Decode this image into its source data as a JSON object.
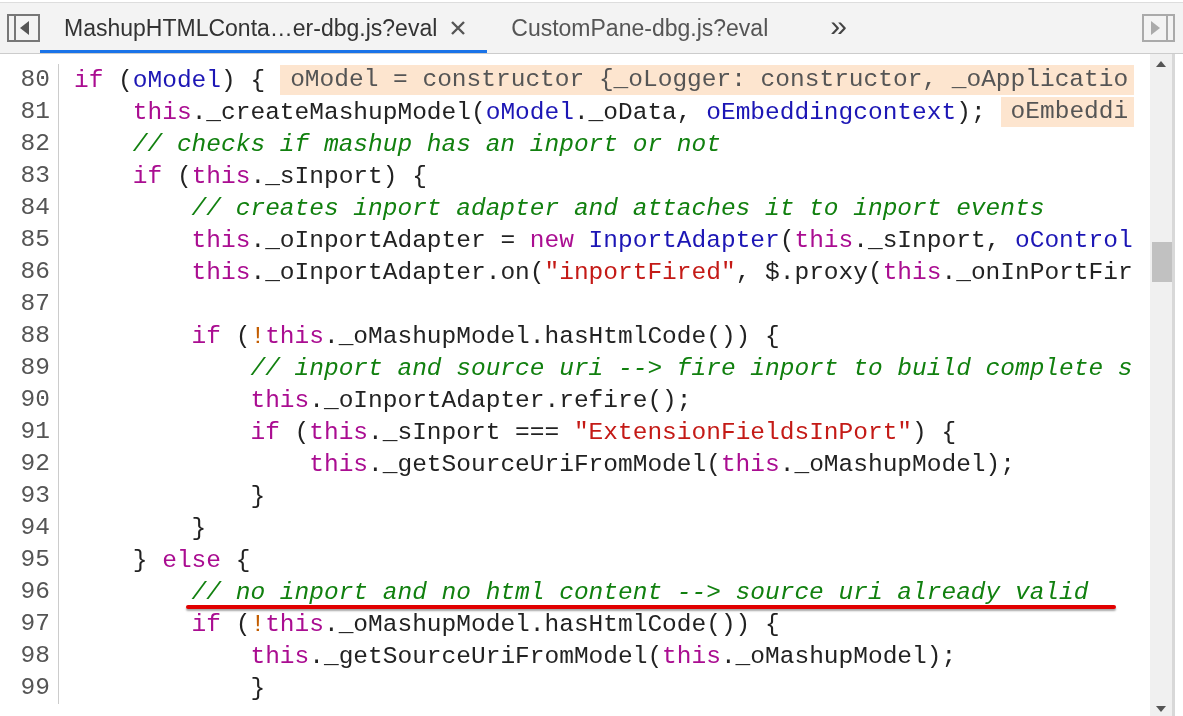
{
  "tabs": [
    {
      "label": "MashupHTMLConta…er-dbg.js?eval",
      "selected": true
    },
    {
      "label": "CustomPane-dbg.js?eval",
      "selected": false
    }
  ],
  "overflow": "»",
  "code_lines": [
    {
      "number": "80",
      "tokens": [
        {
          "kind": "kw",
          "text": "if"
        },
        {
          "kind": "plain",
          "text": " ("
        },
        {
          "kind": "var",
          "text": "oModel"
        },
        {
          "kind": "plain",
          "text": ") {"
        }
      ],
      "hint": "oModel = constructor {_oLogger: constructor, _oApplicatio"
    },
    {
      "number": "81",
      "tokens": [
        {
          "kind": "kw",
          "text": "    this"
        },
        {
          "kind": "plain",
          "text": "._createMashupModel("
        },
        {
          "kind": "var",
          "text": "oModel"
        },
        {
          "kind": "plain",
          "text": "._oData, "
        },
        {
          "kind": "var",
          "text": "oEmbeddingcontext"
        },
        {
          "kind": "plain",
          "text": ");"
        }
      ],
      "hint": "oEmbeddi"
    },
    {
      "number": "82",
      "tokens": [
        {
          "kind": "comment",
          "text": "    // checks if mashup has an inport or not"
        }
      ]
    },
    {
      "number": "83",
      "tokens": [
        {
          "kind": "kw",
          "text": "    if"
        },
        {
          "kind": "plain",
          "text": " ("
        },
        {
          "kind": "kw",
          "text": "this"
        },
        {
          "kind": "plain",
          "text": "._sInport) {"
        }
      ]
    },
    {
      "number": "84",
      "tokens": [
        {
          "kind": "comment",
          "text": "        // creates inport adapter and attaches it to inport events"
        }
      ]
    },
    {
      "number": "85",
      "tokens": [
        {
          "kind": "kw",
          "text": "        this"
        },
        {
          "kind": "plain",
          "text": "._oInportAdapter = "
        },
        {
          "kind": "kw",
          "text": "new "
        },
        {
          "kind": "var",
          "text": "InportAdapter"
        },
        {
          "kind": "plain",
          "text": "("
        },
        {
          "kind": "kw",
          "text": "this"
        },
        {
          "kind": "plain",
          "text": "._sInport, "
        },
        {
          "kind": "var",
          "text": "oControl"
        }
      ]
    },
    {
      "number": "86",
      "tokens": [
        {
          "kind": "kw",
          "text": "        this"
        },
        {
          "kind": "plain",
          "text": "._oInportAdapter.on("
        },
        {
          "kind": "str",
          "text": "\"inportFired\""
        },
        {
          "kind": "plain",
          "text": ", $.proxy("
        },
        {
          "kind": "kw",
          "text": "this"
        },
        {
          "kind": "plain",
          "text": "._onInPortFir"
        }
      ]
    },
    {
      "number": "87"
    },
    {
      "number": "88",
      "tokens": [
        {
          "kind": "kw",
          "text": "        if"
        },
        {
          "kind": "plain",
          "text": " ("
        },
        {
          "kind": "op",
          "text": "!"
        },
        {
          "kind": "kw",
          "text": "this"
        },
        {
          "kind": "plain",
          "text": "._oMashupModel.hasHtmlCode()) {"
        }
      ]
    },
    {
      "number": "89",
      "tokens": [
        {
          "kind": "comment",
          "text": "            // inport and source uri --> fire inport to build complete s"
        }
      ]
    },
    {
      "number": "90",
      "tokens": [
        {
          "kind": "kw",
          "text": "            this"
        },
        {
          "kind": "plain",
          "text": "._oInportAdapter.refire();"
        }
      ]
    },
    {
      "number": "91",
      "tokens": [
        {
          "kind": "kw",
          "text": "            if"
        },
        {
          "kind": "plain",
          "text": " ("
        },
        {
          "kind": "kw",
          "text": "this"
        },
        {
          "kind": "plain",
          "text": "._sInport === "
        },
        {
          "kind": "str",
          "text": "\"ExtensionFieldsInPort\""
        },
        {
          "kind": "plain",
          "text": ") {"
        }
      ]
    },
    {
      "number": "92",
      "tokens": [
        {
          "kind": "kw",
          "text": "                this"
        },
        {
          "kind": "plain",
          "text": "._getSourceUriFromModel("
        },
        {
          "kind": "kw",
          "text": "this"
        },
        {
          "kind": "plain",
          "text": "._oMashupModel);"
        }
      ]
    },
    {
      "number": "93",
      "tokens": [
        {
          "kind": "plain",
          "text": "            }"
        }
      ]
    },
    {
      "number": "94",
      "tokens": [
        {
          "kind": "plain",
          "text": "        }"
        }
      ]
    },
    {
      "number": "95",
      "tokens": [
        {
          "kind": "plain",
          "text": "    } "
        },
        {
          "kind": "kw",
          "text": "else"
        },
        {
          "kind": "plain",
          "text": " {"
        }
      ]
    },
    {
      "number": "96",
      "underlined": true,
      "tokens": [
        {
          "kind": "comment",
          "text": "        // no inport and no html content --> source uri already valid"
        }
      ]
    },
    {
      "number": "97",
      "tokens": [
        {
          "kind": "kw",
          "text": "        if"
        },
        {
          "kind": "plain",
          "text": " ("
        },
        {
          "kind": "op",
          "text": "!"
        },
        {
          "kind": "kw",
          "text": "this"
        },
        {
          "kind": "plain",
          "text": "._oMashupModel.hasHtmlCode()) {"
        }
      ]
    },
    {
      "number": "98",
      "tokens": [
        {
          "kind": "kw",
          "text": "            this"
        },
        {
          "kind": "plain",
          "text": "._getSourceUriFromModel("
        },
        {
          "kind": "kw",
          "text": "this"
        },
        {
          "kind": "plain",
          "text": "._oMashupModel);"
        }
      ]
    },
    {
      "number": "99",
      "tokens": [
        {
          "kind": "plain",
          "text": "            }"
        }
      ]
    }
  ]
}
